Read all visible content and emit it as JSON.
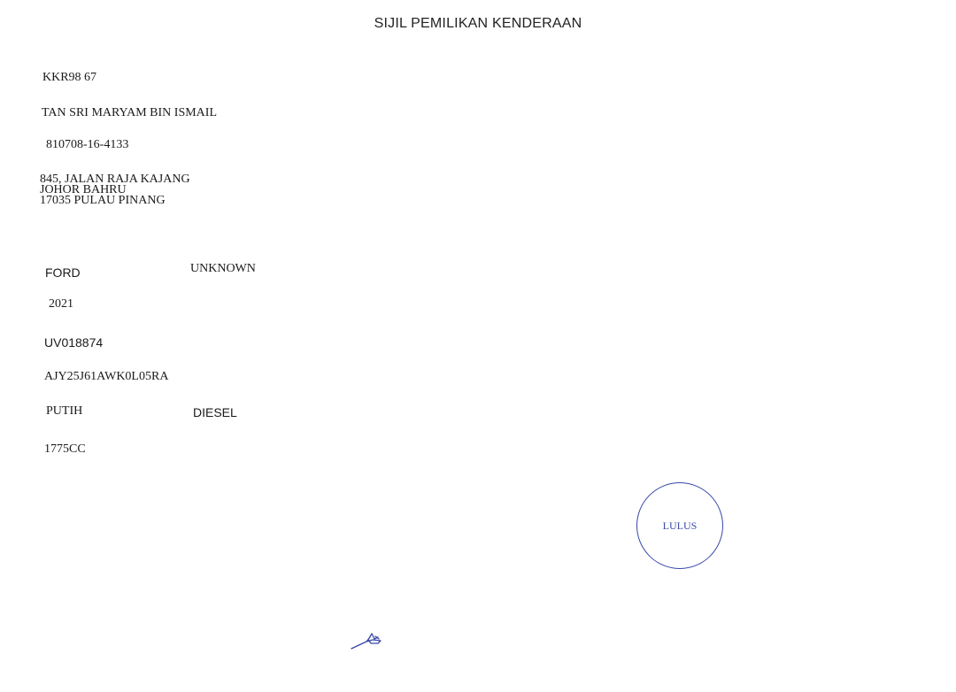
{
  "document": {
    "title": "SIJIL PEMILIKAN KENDERAAN"
  },
  "owner": {
    "registration_no": "KKR98 67",
    "name": "TAN SRI MARYAM BIN ISMAIL",
    "ic_no": "810708-16-4133",
    "address_line1": "845, JALAN RAJA KAJANG",
    "address_line2": "JOHOR BAHRU",
    "address_line3": "17035 PULAU PINANG"
  },
  "vehicle": {
    "make": "FORD",
    "model": "UNKNOWN",
    "year": "2021",
    "engine_no": "UV018874",
    "chassis_no": "AJY25J61AWK0L05RA",
    "color": "PUTIH",
    "fuel": "DIESEL",
    "capacity": "1775CC"
  },
  "stamp": {
    "label": "LULUS",
    "color": "#3747a8"
  },
  "signature": {
    "icon": "handwritten-signature-icon",
    "color": "#3747a8"
  }
}
